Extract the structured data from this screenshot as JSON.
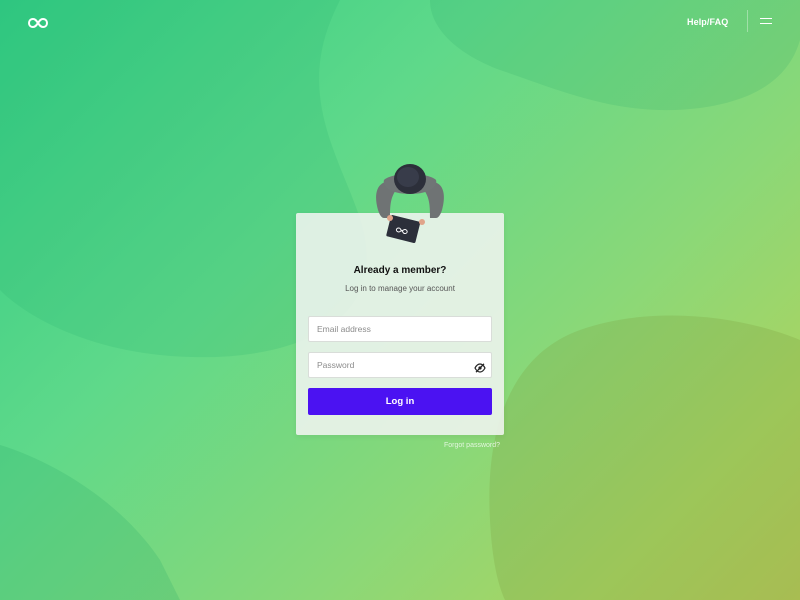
{
  "header": {
    "logo_icon": "infinity-logo-icon",
    "help_label": "Help/FAQ",
    "menu_icon": "hamburger-menu-icon"
  },
  "login": {
    "title": "Already a member?",
    "subtitle": "Log in to manage your account",
    "email_placeholder": "Email address",
    "password_placeholder": "Password",
    "password_toggle_icon": "eye-off-icon",
    "submit_label": "Log in",
    "forgot_label": "Forgot password?"
  },
  "illustration": {
    "icon": "person-with-laptop-illustration"
  },
  "colors": {
    "accent": "#4b12f2",
    "background_start": "#2fcb84",
    "background_end": "#b7c85a",
    "card": "#f0f4f0"
  }
}
